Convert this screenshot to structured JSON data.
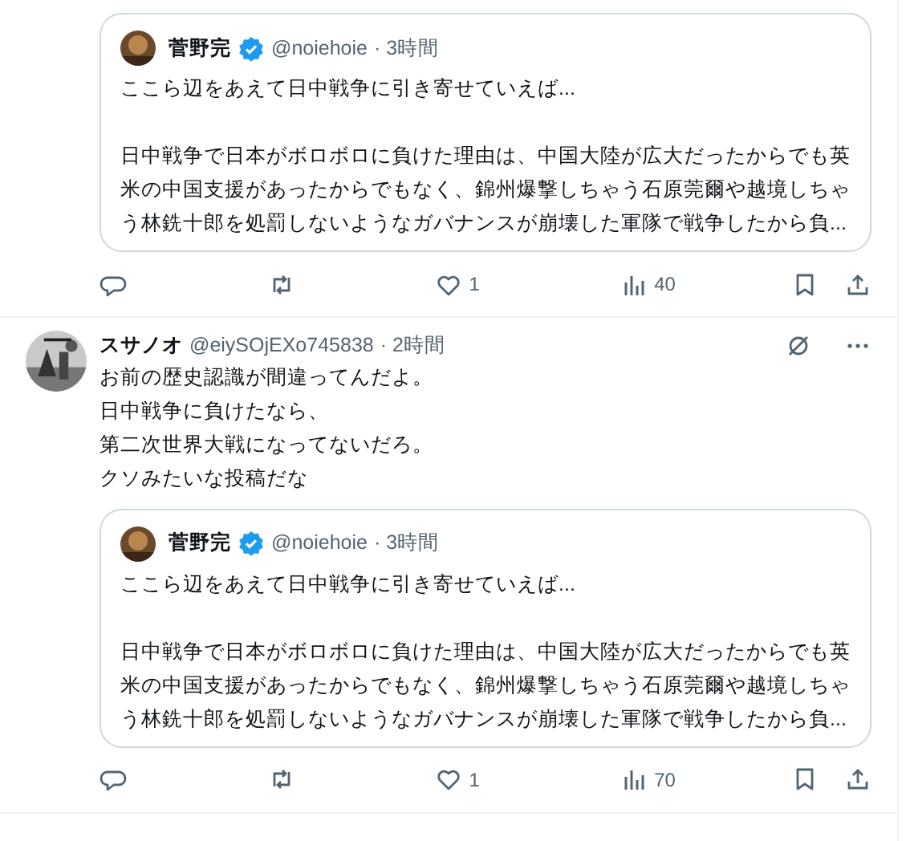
{
  "posts": [
    {
      "quote": {
        "name": "菅野完",
        "verified": true,
        "handle": "@noiehoie",
        "time": "· 3時間",
        "lines": [
          "ここら辺をあえて日中戦争に引き寄せていえば...",
          "日中戦争で日本がボロボロに負けた理由は、中国大陸が広大だったからでも英米の中国支援があったからでもなく、錦州爆撃しちゃう石原莞爾や越境しちゃう林銑十郎を処罰しないようなガバナンスが崩壊した軍隊で戦争したから負..."
        ]
      },
      "actions": {
        "likes": "1",
        "views": "40"
      }
    },
    {
      "author": {
        "name": "スサノオ",
        "handle": "@eiySOjEXo745838",
        "time": "· 2時間"
      },
      "lines": [
        "お前の歴史認識が間違ってんだよ。",
        "日中戦争に負けたなら、",
        "第二次世界大戦になってないだろ。",
        "クソみたいな投稿だな"
      ],
      "quote": {
        "name": "菅野完",
        "verified": true,
        "handle": "@noiehoie",
        "time": "· 3時間",
        "lines": [
          "ここら辺をあえて日中戦争に引き寄せていえば...",
          "日中戦争で日本がボロボロに負けた理由は、中国大陸が広大だったからでも英米の中国支援があったからでもなく、錦州爆撃しちゃう石原莞爾や越境しちゃう林銑十郎を処罰しないようなガバナンスが崩壊した軍隊で戦争したから負..."
        ]
      },
      "actions": {
        "likes": "1",
        "views": "70"
      }
    }
  ]
}
